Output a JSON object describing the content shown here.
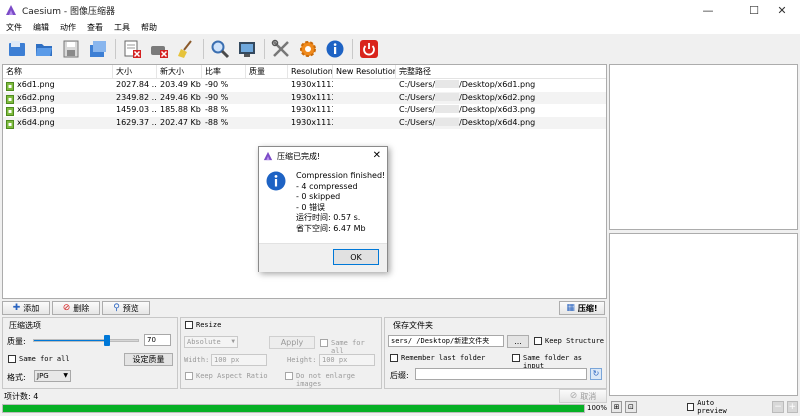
{
  "window": {
    "title": "Caesium - 图像压缩器",
    "minimize": "—",
    "maximize": "☐",
    "close": "✕"
  },
  "menu": [
    "文件",
    "编辑",
    "动作",
    "查看",
    "工具",
    "帮助"
  ],
  "colors": {
    "accent": "#0078d7",
    "progress": "#06b025",
    "file_icon": "#7dba3d",
    "info_blue": "#1e63c4"
  },
  "toolbar": [
    {
      "name": "open-files-icon"
    },
    {
      "name": "open-folder-icon"
    },
    {
      "name": "save-list-icon"
    },
    {
      "name": "save-copy-icon"
    },
    {
      "name": "remove-items-icon"
    },
    {
      "name": "clear-list-icon"
    },
    {
      "name": "broom-icon"
    },
    {
      "name": "zoom-icon"
    },
    {
      "name": "preview-image-icon"
    },
    {
      "name": "tools-icon"
    },
    {
      "name": "settings-gear-icon"
    },
    {
      "name": "about-info-icon"
    },
    {
      "name": "power-exit-icon"
    }
  ],
  "list": {
    "columns": [
      "名称",
      "大小",
      "新大小",
      "比率",
      "质量",
      "Resolution",
      "New Resolution",
      "完整路径"
    ],
    "rows": [
      {
        "name": "x6d1.png",
        "size": "2027.84 ...",
        "new_size": "203.49 Kb",
        "ratio": "-90 %",
        "quality": "",
        "resolution": "1930x1113",
        "new_resolution": "",
        "path_prefix": "C:/Users/",
        "path_suffix": "/Desktop/x6d1.png"
      },
      {
        "name": "x6d2.png",
        "size": "2349.82 ...",
        "new_size": "249.46 Kb",
        "ratio": "-90 %",
        "quality": "",
        "resolution": "1930x1113",
        "new_resolution": "",
        "path_prefix": "C:/Users/",
        "path_suffix": "/Desktop/x6d2.png"
      },
      {
        "name": "x6d3.png",
        "size": "1459.03 ...",
        "new_size": "185.88 Kb",
        "ratio": "-88 %",
        "quality": "",
        "resolution": "1930x1113",
        "new_resolution": "",
        "path_prefix": "C:/Users/",
        "path_suffix": "/Desktop/x6d3.png"
      },
      {
        "name": "x6d4.png",
        "size": "1629.37 ...",
        "new_size": "202.47 Kb",
        "ratio": "-88 %",
        "quality": "",
        "resolution": "1930x1113",
        "new_resolution": "",
        "path_prefix": "C:/Users/",
        "path_suffix": "/Desktop/x6d4.png"
      }
    ]
  },
  "dialog": {
    "title": "压缩已完成!",
    "lines": [
      "Compression finished!",
      "- 4 compressed",
      "- 0 skipped",
      "- 0 错误",
      "运行时间: 0.57 s.",
      "省下空间: 6.47 Mb"
    ],
    "ok": "OK"
  },
  "actions": {
    "add": "添加",
    "remove": "删除",
    "preview": "预览",
    "compress": "压缩!"
  },
  "compression": {
    "title": "压缩选项",
    "quality_label": "质量:",
    "quality_value": "70",
    "quality_fraction": 0.7,
    "same_for_all": "Same for all",
    "set_quality": "设定质量",
    "format_label": "格式:",
    "format_value": "JPG"
  },
  "resize": {
    "title": "Resize",
    "mode": "Absolute",
    "apply": "Apply",
    "same_for_all": "Same for all",
    "width_label": "Width:",
    "width_value": "100 px",
    "height_label": "Height:",
    "height_value": "100 px",
    "keep_aspect": "Keep Aspect Ratio",
    "no_enlarge": "Do not enlarge images"
  },
  "output": {
    "title": "保存文件夹",
    "path": "sers/      /Desktop/新建文件夹",
    "browse": "...",
    "keep_structure": "Keep Structure",
    "remember_last": "Remember last folder",
    "same_as_input": "Same folder as input",
    "suffix_label": "后缀:",
    "suffix_value": ""
  },
  "status": {
    "count_label": "项计数: 4",
    "cancel": "取消",
    "progress_text": "100%",
    "progress_fraction": 1.0
  },
  "preview": {
    "auto_preview": "Auto preview"
  }
}
